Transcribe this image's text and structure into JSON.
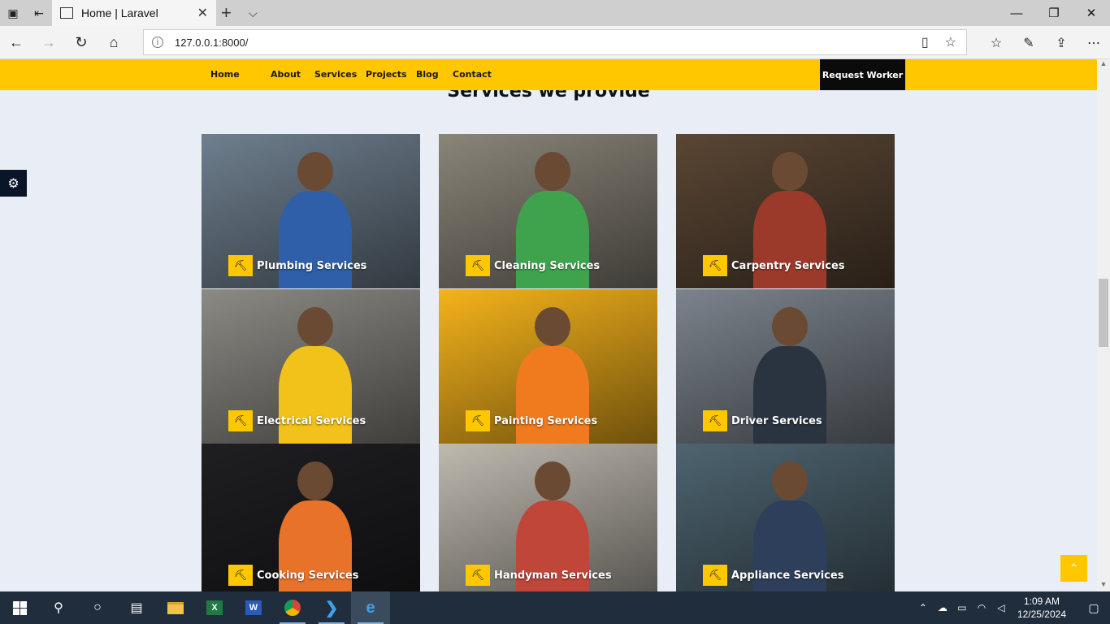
{
  "browser": {
    "tab_title": "Home | Laravel",
    "tab_close": "✕",
    "new_tab": "+",
    "tab_menu": "⌵",
    "url": "127.0.0.1:8000/",
    "window_controls": {
      "minimize": "—",
      "restore": "❐",
      "close": "✕"
    },
    "icons": {
      "back": "←",
      "forward": "→",
      "refresh": "↻",
      "home": "⌂",
      "info": "i",
      "reading": "▯",
      "favorite": "☆",
      "favorites_hub": "☆",
      "pen": "✎",
      "share": "⇪",
      "more": "⋯"
    }
  },
  "nav": {
    "links": [
      "Home",
      "About",
      "Services",
      "Projects",
      "Blog",
      "Contact"
    ],
    "request_button": "Request Worker"
  },
  "section": {
    "title": "Services we provide"
  },
  "services": [
    {
      "label": "Plumbing Services",
      "bg": "#6f7f8e",
      "accent": "#2f5fa8"
    },
    {
      "label": "Cleaning Services",
      "bg": "#8a8579",
      "accent": "#3fa34d"
    },
    {
      "label": "Carpentry Services",
      "bg": "#5a4634",
      "accent": "#9b3a2a"
    },
    {
      "label": "Electrical Services",
      "bg": "#8c8a84",
      "accent": "#f2c21b"
    },
    {
      "label": "Painting Services",
      "bg": "#f5b31c",
      "accent": "#f07b1f"
    },
    {
      "label": "Driver Services",
      "bg": "#7b838c",
      "accent": "#2a3340"
    },
    {
      "label": "Cooking Services",
      "bg": "#1f1f22",
      "accent": "#e8722a"
    },
    {
      "label": "Handyman Services",
      "bg": "#bfbab0",
      "accent": "#c0463a"
    },
    {
      "label": "Appliance Services",
      "bg": "#4e6470",
      "accent": "#2e3f5c"
    }
  ],
  "service_icon": "⛏",
  "widgets": {
    "settings_icon": "⚙",
    "scroll_top_icon": "⌃"
  },
  "taskbar": {
    "time": "1:09 AM",
    "date": "12/25/2024",
    "apps": [
      "start",
      "search",
      "cortana",
      "task-view",
      "file-explorer",
      "excel",
      "word",
      "chrome",
      "vscode",
      "edge"
    ]
  }
}
